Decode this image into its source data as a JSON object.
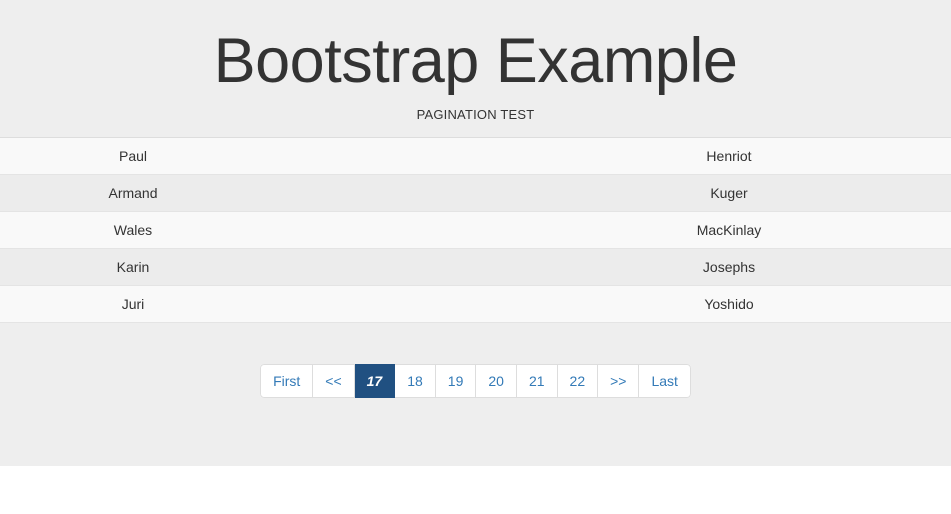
{
  "header": {
    "title": "Bootstrap Example",
    "subtitle": "PAGINATION TEST"
  },
  "table": {
    "rows": [
      {
        "first": "Paul",
        "last": "Henriot"
      },
      {
        "first": "Armand",
        "last": "Kuger"
      },
      {
        "first": "Wales",
        "last": "MacKinlay"
      },
      {
        "first": "Karin",
        "last": "Josephs"
      },
      {
        "first": "Juri",
        "last": "Yoshido"
      }
    ]
  },
  "pagination": {
    "active_page": "17",
    "items": [
      {
        "label": "First",
        "name": "first",
        "active": false
      },
      {
        "label": "<<",
        "name": "prev",
        "active": false
      },
      {
        "label": "17",
        "name": "page-17",
        "active": true
      },
      {
        "label": "18",
        "name": "page-18",
        "active": false
      },
      {
        "label": "19",
        "name": "page-19",
        "active": false
      },
      {
        "label": "20",
        "name": "page-20",
        "active": false
      },
      {
        "label": "21",
        "name": "page-21",
        "active": false
      },
      {
        "label": "22",
        "name": "page-22",
        "active": false
      },
      {
        "label": ">>",
        "name": "next",
        "active": false
      },
      {
        "label": "Last",
        "name": "last",
        "active": false
      }
    ]
  },
  "colors": {
    "band": "#eeeeee",
    "link": "#337ab7",
    "active_bg": "#205081",
    "row_odd": "#f9f9f9",
    "row_even": "#ececec",
    "border": "#dddddd",
    "text": "#333333"
  }
}
